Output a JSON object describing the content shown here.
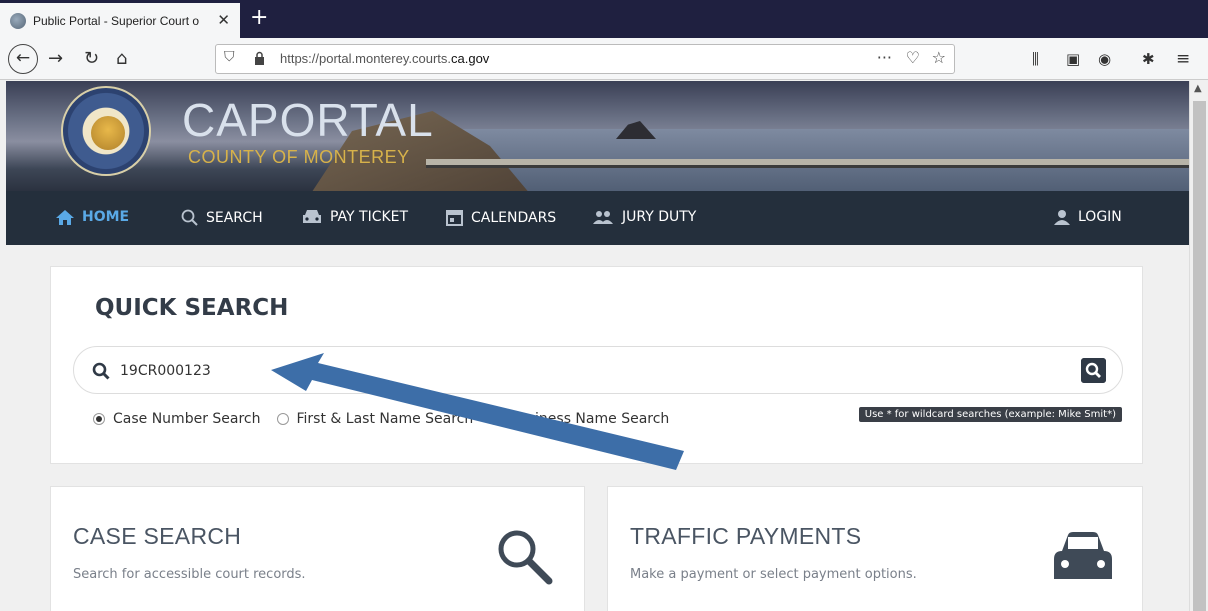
{
  "browser": {
    "tab_title": "Public Portal - Superior Court o",
    "tab_close": "✕",
    "new_tab": "+",
    "url_prefix": "https://portal.monterey.courts.",
    "url_domain": "ca.gov",
    "more_dots": "···"
  },
  "site": {
    "brand_title": "CAPORTAL",
    "brand_subtitle": "COUNTY OF MONTEREY"
  },
  "nav": {
    "home": "HOME",
    "search": "SEARCH",
    "pay_ticket": "PAY TICKET",
    "calendars": "CALENDARS",
    "jury_duty": "JURY DUTY",
    "login": "LOGIN"
  },
  "quick_search": {
    "title": "QUICK SEARCH",
    "value": "19CR000123",
    "options": {
      "case_number": "Case Number Search",
      "name": "First & Last Name Search",
      "business": "Business Name Search"
    },
    "selected": "case_number",
    "tip": "Use * for wildcard searches (example: Mike Smit*)"
  },
  "cards": {
    "case_search": {
      "title": "CASE SEARCH",
      "desc": "Search for accessible court records."
    },
    "traffic": {
      "title": "TRAFFIC PAYMENTS",
      "desc": "Make a payment or select payment options."
    }
  },
  "colors": {
    "nav_active": "#5aa9e6",
    "arrow": "#3d6ea8",
    "brand_gold": "#d7b24a"
  }
}
